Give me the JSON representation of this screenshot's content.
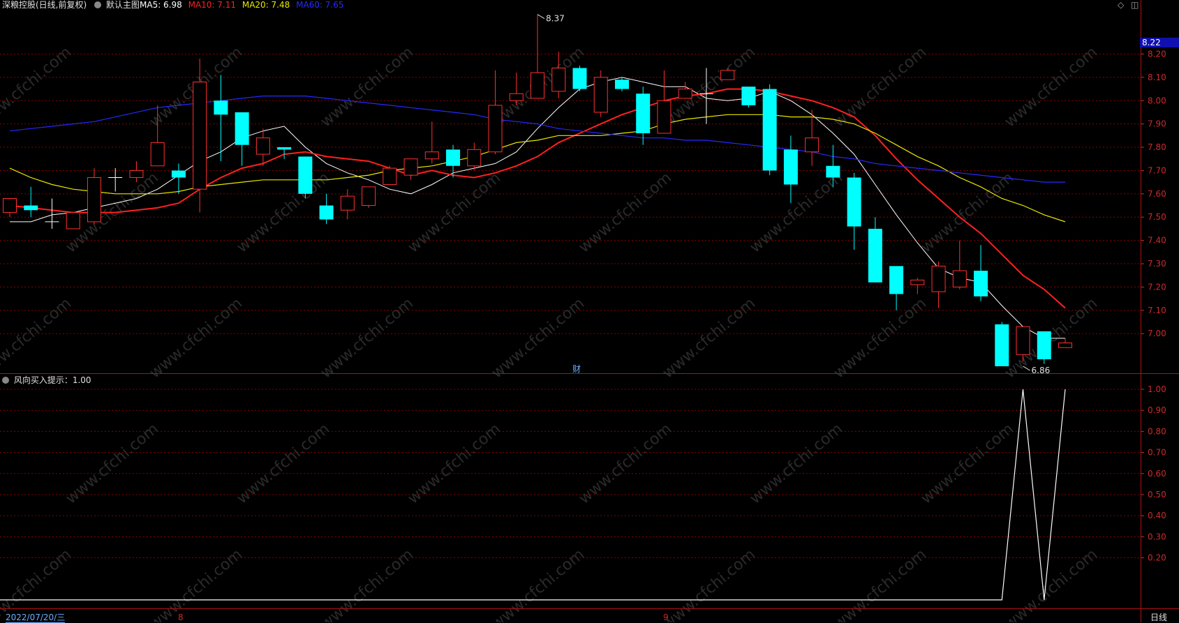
{
  "header": {
    "stock_label": "深粮控股(日线,前复权)",
    "main_chart_label": "默认主图",
    "ma5_label": "MA5: 6.98",
    "ma10_label": "MA10: 7.11",
    "ma20_label": "MA20: 7.48",
    "ma60_label": "MA60: 7.65",
    "ma_colors": {
      "ma5": "#ffffff",
      "ma10": "#ff2020",
      "ma20": "#e8e800",
      "ma60": "#2828ff"
    }
  },
  "indicator": {
    "label": "风向买入提示：1.00"
  },
  "footer": {
    "date_label": "2022/07/20/三",
    "month_labels": [
      "8",
      "9"
    ],
    "period_label": "日线"
  },
  "main_marker": "财",
  "current_price_label": "8.22",
  "watermark": "www.cfchi.com",
  "colors": {
    "up": "#ff3030",
    "down": "#00ffff",
    "grid": "#8a0000",
    "axis_text": "#cc2a2a"
  },
  "chart_data": [
    {
      "type": "candlestick",
      "title": "深粮控股(日线,前复权)",
      "y_ticks": [
        8.2,
        8.1,
        8.0,
        7.9,
        7.8,
        7.7,
        7.6,
        7.5,
        7.4,
        7.3,
        7.2,
        7.1,
        7.0
      ],
      "ylim": [
        6.83,
        8.39
      ],
      "annotations": [
        {
          "label": "8.37",
          "index": 25,
          "value": 8.37
        },
        {
          "label": "6.86",
          "index": 48,
          "value": 6.86
        }
      ],
      "candles": [
        {
          "o": 7.52,
          "h": 7.58,
          "l": 7.5,
          "c": 7.58
        },
        {
          "o": 7.55,
          "h": 7.63,
          "l": 7.5,
          "c": 7.53
        },
        {
          "o": 7.48,
          "h": 7.58,
          "l": 7.45,
          "c": 7.48
        },
        {
          "o": 7.45,
          "h": 7.52,
          "l": 7.45,
          "c": 7.52
        },
        {
          "o": 7.48,
          "h": 7.71,
          "l": 7.47,
          "c": 7.67
        },
        {
          "o": 7.67,
          "h": 7.71,
          "l": 7.61,
          "c": 7.67
        },
        {
          "o": 7.67,
          "h": 7.74,
          "l": 7.65,
          "c": 7.7
        },
        {
          "o": 7.72,
          "h": 7.98,
          "l": 7.72,
          "c": 7.82
        },
        {
          "o": 7.7,
          "h": 7.73,
          "l": 7.6,
          "c": 7.67
        },
        {
          "o": 7.62,
          "h": 8.18,
          "l": 7.52,
          "c": 8.08
        },
        {
          "o": 8.0,
          "h": 8.11,
          "l": 7.74,
          "c": 7.94
        },
        {
          "o": 7.95,
          "h": 7.95,
          "l": 7.72,
          "c": 7.81
        },
        {
          "o": 7.77,
          "h": 7.88,
          "l": 7.72,
          "c": 7.84
        },
        {
          "o": 7.8,
          "h": 7.8,
          "l": 7.75,
          "c": 7.79
        },
        {
          "o": 7.76,
          "h": 7.76,
          "l": 7.58,
          "c": 7.6
        },
        {
          "o": 7.55,
          "h": 7.6,
          "l": 7.47,
          "c": 7.49
        },
        {
          "o": 7.53,
          "h": 7.62,
          "l": 7.49,
          "c": 7.59
        },
        {
          "o": 7.55,
          "h": 7.63,
          "l": 7.54,
          "c": 7.63
        },
        {
          "o": 7.64,
          "h": 7.72,
          "l": 7.64,
          "c": 7.71
        },
        {
          "o": 7.68,
          "h": 7.75,
          "l": 7.66,
          "c": 7.75
        },
        {
          "o": 7.75,
          "h": 7.91,
          "l": 7.73,
          "c": 7.78
        },
        {
          "o": 7.79,
          "h": 7.81,
          "l": 7.67,
          "c": 7.72
        },
        {
          "o": 7.72,
          "h": 7.82,
          "l": 7.7,
          "c": 7.79
        },
        {
          "o": 7.78,
          "h": 8.13,
          "l": 7.77,
          "c": 7.98
        },
        {
          "o": 8.0,
          "h": 8.12,
          "l": 7.98,
          "c": 8.03
        },
        {
          "o": 8.01,
          "h": 8.37,
          "l": 8.01,
          "c": 8.12
        },
        {
          "o": 8.04,
          "h": 8.21,
          "l": 8.01,
          "c": 8.14
        },
        {
          "o": 8.14,
          "h": 8.15,
          "l": 8.04,
          "c": 8.05
        },
        {
          "o": 7.95,
          "h": 8.13,
          "l": 7.93,
          "c": 8.1
        },
        {
          "o": 8.09,
          "h": 8.1,
          "l": 8.04,
          "c": 8.05
        },
        {
          "o": 8.03,
          "h": 8.06,
          "l": 7.81,
          "c": 7.86
        },
        {
          "o": 7.86,
          "h": 8.13,
          "l": 7.86,
          "c": 8.0
        },
        {
          "o": 8.01,
          "h": 8.08,
          "l": 8.01,
          "c": 8.05
        },
        {
          "o": 8.03,
          "h": 8.14,
          "l": 7.9,
          "c": 8.03
        },
        {
          "o": 8.09,
          "h": 8.14,
          "l": 8.09,
          "c": 8.13
        },
        {
          "o": 8.06,
          "h": 8.06,
          "l": 7.97,
          "c": 7.98
        },
        {
          "o": 8.05,
          "h": 8.07,
          "l": 7.68,
          "c": 7.7
        },
        {
          "o": 7.79,
          "h": 7.85,
          "l": 7.56,
          "c": 7.64
        },
        {
          "o": 7.78,
          "h": 7.96,
          "l": 7.72,
          "c": 7.84
        },
        {
          "o": 7.72,
          "h": 7.81,
          "l": 7.63,
          "c": 7.67
        },
        {
          "o": 7.67,
          "h": 7.69,
          "l": 7.36,
          "c": 7.46
        },
        {
          "o": 7.45,
          "h": 7.5,
          "l": 7.22,
          "c": 7.22
        },
        {
          "o": 7.29,
          "h": 7.29,
          "l": 7.1,
          "c": 7.17
        },
        {
          "o": 7.21,
          "h": 7.24,
          "l": 7.17,
          "c": 7.23
        },
        {
          "o": 7.18,
          "h": 7.31,
          "l": 7.11,
          "c": 7.29
        },
        {
          "o": 7.2,
          "h": 7.4,
          "l": 7.19,
          "c": 7.27
        },
        {
          "o": 7.27,
          "h": 7.38,
          "l": 7.14,
          "c": 7.16
        },
        {
          "o": 7.04,
          "h": 7.05,
          "l": 6.86,
          "c": 6.86
        },
        {
          "o": 6.91,
          "h": 7.03,
          "l": 6.88,
          "c": 7.03
        },
        {
          "o": 7.01,
          "h": 7.01,
          "l": 6.87,
          "c": 6.89
        },
        {
          "o": 6.94,
          "h": 6.98,
          "l": 6.94,
          "c": 6.96
        }
      ],
      "series": [
        {
          "name": "MA5",
          "values": [
            7.48,
            7.48,
            7.51,
            7.52,
            7.54,
            7.56,
            7.58,
            7.62,
            7.68,
            7.74,
            7.78,
            7.84,
            7.87,
            7.89,
            7.8,
            7.73,
            7.69,
            7.66,
            7.62,
            7.6,
            7.64,
            7.69,
            7.71,
            7.73,
            7.78,
            7.88,
            7.97,
            8.05,
            8.08,
            8.1,
            8.08,
            8.06,
            8.06,
            8.01,
            8.0,
            8.01,
            8.04,
            8.0,
            7.94,
            7.86,
            7.77,
            7.64,
            7.51,
            7.39,
            7.28,
            7.24,
            7.22,
            7.12,
            7.03,
            6.98,
            6.98
          ]
        },
        {
          "name": "MA10",
          "values": [
            7.55,
            7.54,
            7.53,
            7.52,
            7.52,
            7.52,
            7.53,
            7.54,
            7.56,
            7.62,
            7.67,
            7.71,
            7.73,
            7.77,
            7.78,
            7.76,
            7.75,
            7.74,
            7.71,
            7.68,
            7.7,
            7.68,
            7.67,
            7.69,
            7.72,
            7.76,
            7.82,
            7.86,
            7.9,
            7.94,
            7.97,
            8.0,
            8.02,
            8.03,
            8.05,
            8.05,
            8.04,
            8.02,
            8.0,
            7.97,
            7.93,
            7.85,
            7.75,
            7.66,
            7.58,
            7.5,
            7.43,
            7.34,
            7.25,
            7.19,
            7.11
          ]
        },
        {
          "name": "MA20",
          "values": [
            7.71,
            7.67,
            7.64,
            7.62,
            7.61,
            7.6,
            7.6,
            7.6,
            7.61,
            7.63,
            7.64,
            7.65,
            7.66,
            7.66,
            7.66,
            7.66,
            7.67,
            7.68,
            7.7,
            7.71,
            7.72,
            7.74,
            7.76,
            7.79,
            7.82,
            7.83,
            7.85,
            7.85,
            7.85,
            7.86,
            7.87,
            7.9,
            7.92,
            7.93,
            7.94,
            7.94,
            7.94,
            7.93,
            7.93,
            7.92,
            7.9,
            7.86,
            7.81,
            7.76,
            7.72,
            7.67,
            7.63,
            7.58,
            7.55,
            7.51,
            7.48
          ]
        },
        {
          "name": "MA60",
          "values": [
            7.87,
            7.88,
            7.89,
            7.9,
            7.91,
            7.93,
            7.95,
            7.97,
            7.98,
            7.99,
            8.0,
            8.01,
            8.02,
            8.02,
            8.02,
            8.01,
            8.0,
            7.99,
            7.98,
            7.97,
            7.96,
            7.95,
            7.94,
            7.92,
            7.91,
            7.9,
            7.88,
            7.87,
            7.86,
            7.85,
            7.84,
            7.84,
            7.83,
            7.83,
            7.82,
            7.81,
            7.8,
            7.79,
            7.78,
            7.76,
            7.75,
            7.73,
            7.72,
            7.71,
            7.7,
            7.69,
            7.68,
            7.67,
            7.66,
            7.65,
            7.65
          ]
        }
      ]
    },
    {
      "type": "line",
      "title": "风向买入提示：1.00",
      "y_ticks": [
        1.0,
        0.9,
        0.8,
        0.7,
        0.6,
        0.5,
        0.4,
        0.3,
        0.2
      ],
      "ylim": [
        -0.04,
        1.0
      ],
      "series": [
        {
          "name": "风向买入提示",
          "values": [
            0,
            0,
            0,
            0,
            0,
            0,
            0,
            0,
            0,
            0,
            0,
            0,
            0,
            0,
            0,
            0,
            0,
            0,
            0,
            0,
            0,
            0,
            0,
            0,
            0,
            0,
            0,
            0,
            0,
            0,
            0,
            0,
            0,
            0,
            0,
            0,
            0,
            0,
            0,
            0,
            0,
            0,
            0,
            0,
            0,
            0,
            0,
            0,
            1,
            0,
            1
          ]
        }
      ]
    }
  ]
}
